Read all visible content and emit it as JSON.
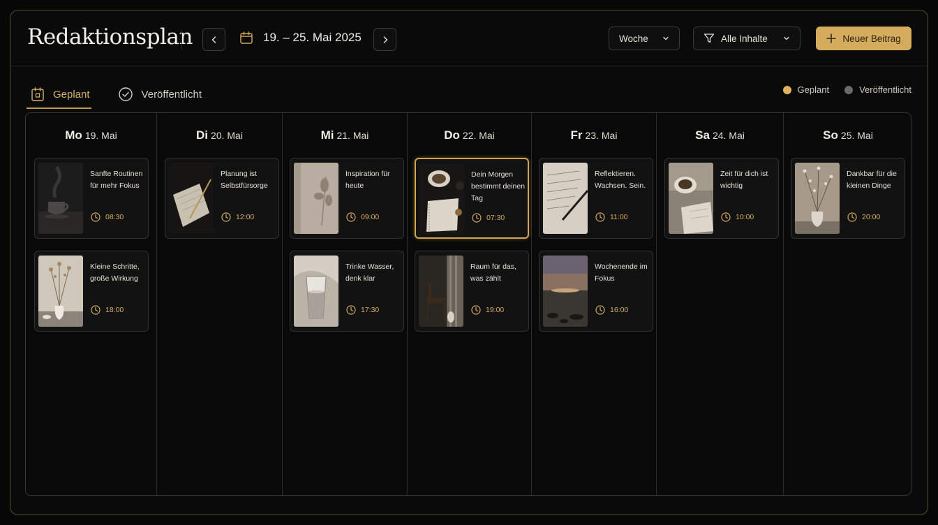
{
  "header": {
    "title": "Redaktionsplan",
    "date_range": "19. – 25. Mai 2025",
    "view_select": "Woche",
    "filter_select": "Alle Inhalte",
    "new_button": "Neuer Beitrag"
  },
  "tabs": [
    {
      "label": "Geplant",
      "icon": "calendar-icon",
      "active": true
    },
    {
      "label": "Veröffentlicht",
      "icon": "check-circle-icon",
      "active": false
    }
  ],
  "legend": [
    {
      "label": "Geplant",
      "color": "#e0b25c"
    },
    {
      "label": "Veröffentlicht",
      "color": "#6a6a6a"
    }
  ],
  "colors": {
    "accent": "#d5ac5d",
    "border": "#5a4a2c"
  },
  "days": [
    {
      "name": "Mo",
      "date": "19. Mai",
      "posts": [
        {
          "title": "Sanfte Routinen für mehr Fokus",
          "time": "08:30",
          "image": "coffee-steam"
        },
        {
          "title": "Kleine Schritte, große Wirkung",
          "time": "18:00",
          "image": "vase-flowers"
        }
      ]
    },
    {
      "name": "Di",
      "date": "20. Mai",
      "posts": [
        {
          "title": "Planung ist Selbstfürsorge",
          "time": "12:00",
          "image": "notebook-pen"
        }
      ]
    },
    {
      "name": "Mi",
      "date": "21. Mai",
      "posts": [
        {
          "title": "Inspiration für heute",
          "time": "09:00",
          "image": "leaf-shadow"
        },
        {
          "title": "Trinke Wasser, denk klar",
          "time": "17:30",
          "image": "water-glass"
        }
      ]
    },
    {
      "name": "Do",
      "date": "22. Mai",
      "posts": [
        {
          "title": "Dein Morgen bestimmt deinen Tag",
          "time": "07:30",
          "image": "coffee-notebook",
          "highlight": true
        },
        {
          "title": "Raum für das, was zählt",
          "time": "19:00",
          "image": "chair-room"
        }
      ]
    },
    {
      "name": "Fr",
      "date": "23. Mai",
      "posts": [
        {
          "title": "Reflektieren. Wachsen. Sein.",
          "time": "11:00",
          "image": "handwriting"
        },
        {
          "title": "Wochenende im Fokus",
          "time": "16:00",
          "image": "sea-sunset"
        }
      ]
    },
    {
      "name": "Sa",
      "date": "24. Mai",
      "posts": [
        {
          "title": "Zeit für dich ist wichtig",
          "time": "10:00",
          "image": "coffee-book"
        }
      ]
    },
    {
      "name": "So",
      "date": "25. Mai",
      "posts": [
        {
          "title": "Dankbar für die kleinen Dinge",
          "time": "20:00",
          "image": "dried-flowers"
        }
      ]
    }
  ]
}
